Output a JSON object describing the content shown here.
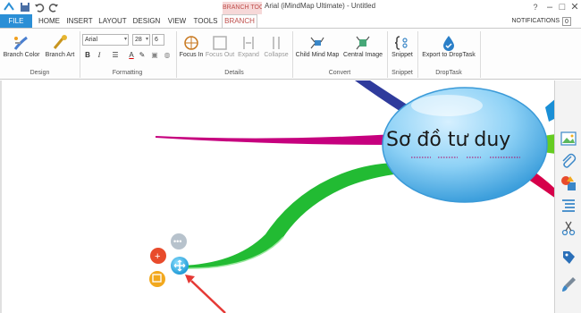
{
  "window": {
    "title": "Arial (iMindMap Ultimate) - Untitled",
    "context_tab_title": "BRANCH TOOLS"
  },
  "tabs": [
    {
      "label": "FILE"
    },
    {
      "label": "HOME"
    },
    {
      "label": "INSERT"
    },
    {
      "label": "LAYOUT"
    },
    {
      "label": "DESIGN"
    },
    {
      "label": "VIEW"
    },
    {
      "label": "TOOLS"
    },
    {
      "label": "BRANCH"
    }
  ],
  "notifications": {
    "label": "NOTIFICATIONS",
    "count": "0"
  },
  "help_label": "?",
  "ribbon": {
    "design": {
      "label": "Design",
      "branch_color": "Branch Color",
      "branch_art": "Branch Art"
    },
    "formatting": {
      "label": "Formatting",
      "font_name": "Arial",
      "font_size": "28",
      "font_size_2": "6"
    },
    "details": {
      "label": "Details",
      "focus_in": "Focus In",
      "focus_out": "Focus Out",
      "expand": "Expand",
      "collapse": "Collapse"
    },
    "convert": {
      "label": "Convert",
      "child_mind_map": "Child Mind Map",
      "central_image": "Central Image"
    },
    "snippet": {
      "label": "Snippet",
      "snippet": "Snippet"
    },
    "droptask": {
      "label": "DropTask",
      "export": "Export to DropTask"
    }
  },
  "canvas": {
    "central_topic": "Sơ đồ tư duy",
    "branch_colors": [
      "#2f3b9c",
      "#c6007e",
      "#22bb33",
      "#1a8fd6",
      "#d6004a",
      "#55cc22"
    ],
    "central_color": "#7ec9f2"
  },
  "sidebar": {
    "icons": [
      "image-icon",
      "attachment-icon",
      "shapes-icon",
      "list-icon",
      "cut-icon",
      "tag-icon",
      "paint-brush-icon"
    ]
  }
}
